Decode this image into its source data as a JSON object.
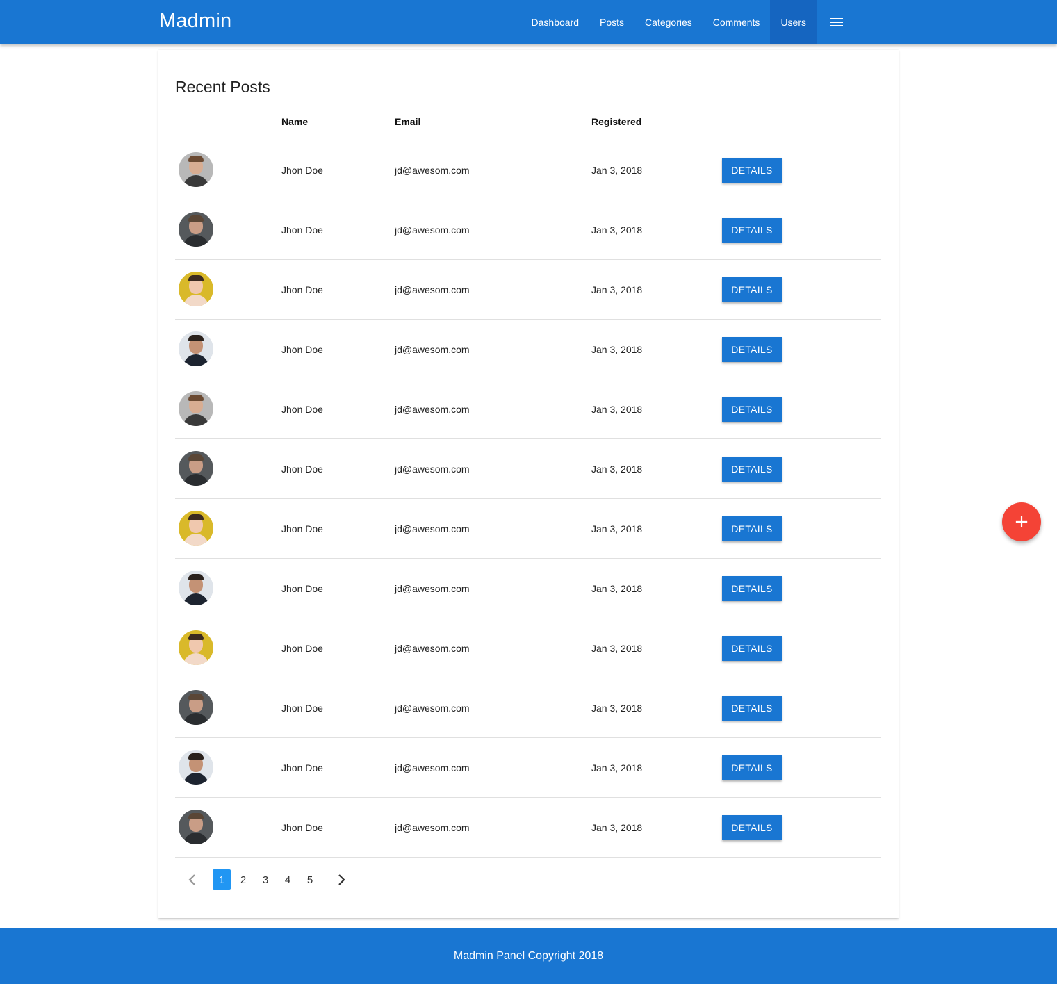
{
  "navbar": {
    "brand": "Madmin",
    "items": [
      {
        "label": "Dashboard",
        "active": false
      },
      {
        "label": "Posts",
        "active": false
      },
      {
        "label": "Categories",
        "active": false
      },
      {
        "label": "Comments",
        "active": false
      },
      {
        "label": "Users",
        "active": true
      }
    ],
    "menu_icon": "hamburger-menu-icon",
    "colors": {
      "bar": "#1976d2",
      "active": "#1565c0"
    }
  },
  "card": {
    "title": "Recent Posts",
    "columns": [
      "",
      "Name",
      "Email",
      "Registered",
      ""
    ],
    "rows": [
      {
        "avatar": "avatar-man-glasses",
        "name": "Jhon Doe",
        "email": "jd@awesom.com",
        "registered": "Jan 3, 2018",
        "action": "DETAILS"
      },
      {
        "avatar": "avatar-man-dark",
        "name": "Jhon Doe",
        "email": "jd@awesom.com",
        "registered": "Jan 3, 2018",
        "action": "DETAILS"
      },
      {
        "avatar": "avatar-woman-yellow",
        "name": "Jhon Doe",
        "email": "jd@awesom.com",
        "registered": "Jan 3, 2018",
        "action": "DETAILS"
      },
      {
        "avatar": "avatar-man-beard",
        "name": "Jhon Doe",
        "email": "jd@awesom.com",
        "registered": "Jan 3, 2018",
        "action": "DETAILS"
      },
      {
        "avatar": "avatar-man-glasses",
        "name": "Jhon Doe",
        "email": "jd@awesom.com",
        "registered": "Jan 3, 2018",
        "action": "DETAILS"
      },
      {
        "avatar": "avatar-man-dark",
        "name": "Jhon Doe",
        "email": "jd@awesom.com",
        "registered": "Jan 3, 2018",
        "action": "DETAILS"
      },
      {
        "avatar": "avatar-woman-yellow",
        "name": "Jhon Doe",
        "email": "jd@awesom.com",
        "registered": "Jan 3, 2018",
        "action": "DETAILS"
      },
      {
        "avatar": "avatar-man-beard",
        "name": "Jhon Doe",
        "email": "jd@awesom.com",
        "registered": "Jan 3, 2018",
        "action": "DETAILS"
      },
      {
        "avatar": "avatar-woman-yellow",
        "name": "Jhon Doe",
        "email": "jd@awesom.com",
        "registered": "Jan 3, 2018",
        "action": "DETAILS"
      },
      {
        "avatar": "avatar-man-dark",
        "name": "Jhon Doe",
        "email": "jd@awesom.com",
        "registered": "Jan 3, 2018",
        "action": "DETAILS"
      },
      {
        "avatar": "avatar-man-beard",
        "name": "Jhon Doe",
        "email": "jd@awesom.com",
        "registered": "Jan 3, 2018",
        "action": "DETAILS"
      },
      {
        "avatar": "avatar-man-dark",
        "name": "Jhon Doe",
        "email": "jd@awesom.com",
        "registered": "Jan 3, 2018",
        "action": "DETAILS"
      }
    ],
    "pagination": {
      "prev_icon": "chevron-left-icon",
      "next_icon": "chevron-right-icon",
      "pages": [
        "1",
        "2",
        "3",
        "4",
        "5"
      ],
      "current": "1"
    }
  },
  "fab": {
    "icon": "plus-icon",
    "label": "+",
    "color": "#f44336"
  },
  "footer": {
    "text": "Madmin Panel Copyright 2018"
  },
  "avatar_styles": {
    "avatar-man-glasses": {
      "bg": "#b8b8b8",
      "skin": "#d8ad92",
      "hair": "#6b4a32",
      "body": "#3a3a3a"
    },
    "avatar-man-dark": {
      "bg": "#55595c",
      "skin": "#c99d86",
      "hair": "#5a4636",
      "body": "#2a2d30"
    },
    "avatar-woman-yellow": {
      "bg": "#d9b92a",
      "skin": "#f0c8ae",
      "hair": "#3b2a20",
      "body": "#f2d9c8"
    },
    "avatar-man-beard": {
      "bg": "#dfe4ea",
      "skin": "#c49275",
      "hair": "#2a211c",
      "body": "#1d2430"
    }
  }
}
